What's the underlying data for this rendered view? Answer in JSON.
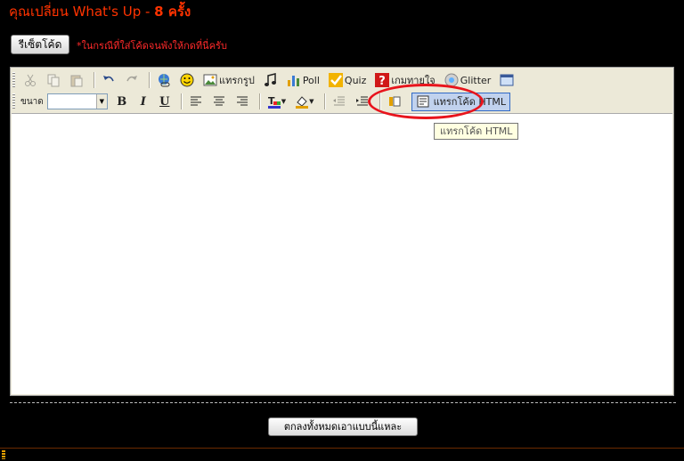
{
  "page": {
    "title_prefix": "คุณเปลี่ยน What's Up - ",
    "title_count": "8 ครั้ง",
    "reset_button": "รีเซ็ตโค้ด",
    "reset_note": "*ในกรณีที่ใส่โค้ดจนพังให้กดที่นี่ครับ",
    "submit_button": "ตกลงทั้งหมดเอาแบบนี้แหละ"
  },
  "toolbar": {
    "row1": {
      "insert_image_label": "แทรกรูป",
      "poll_label": "Poll",
      "quiz_label": "Quiz",
      "game_label": "เกมทายใจ",
      "glitter_label": "Glitter"
    },
    "row2": {
      "size_label": "ขนาด",
      "size_value": "",
      "bold": "B",
      "italic": "I",
      "underline": "U",
      "insert_html_label": "แทรกโค้ด HTML"
    }
  },
  "tooltip": "แทรกโค้ด HTML",
  "colors": {
    "background": "#000000",
    "title": "#ff3300",
    "note": "#ff2a2a",
    "highlight": "#e8141c",
    "toolbar": "#ece9d8"
  }
}
